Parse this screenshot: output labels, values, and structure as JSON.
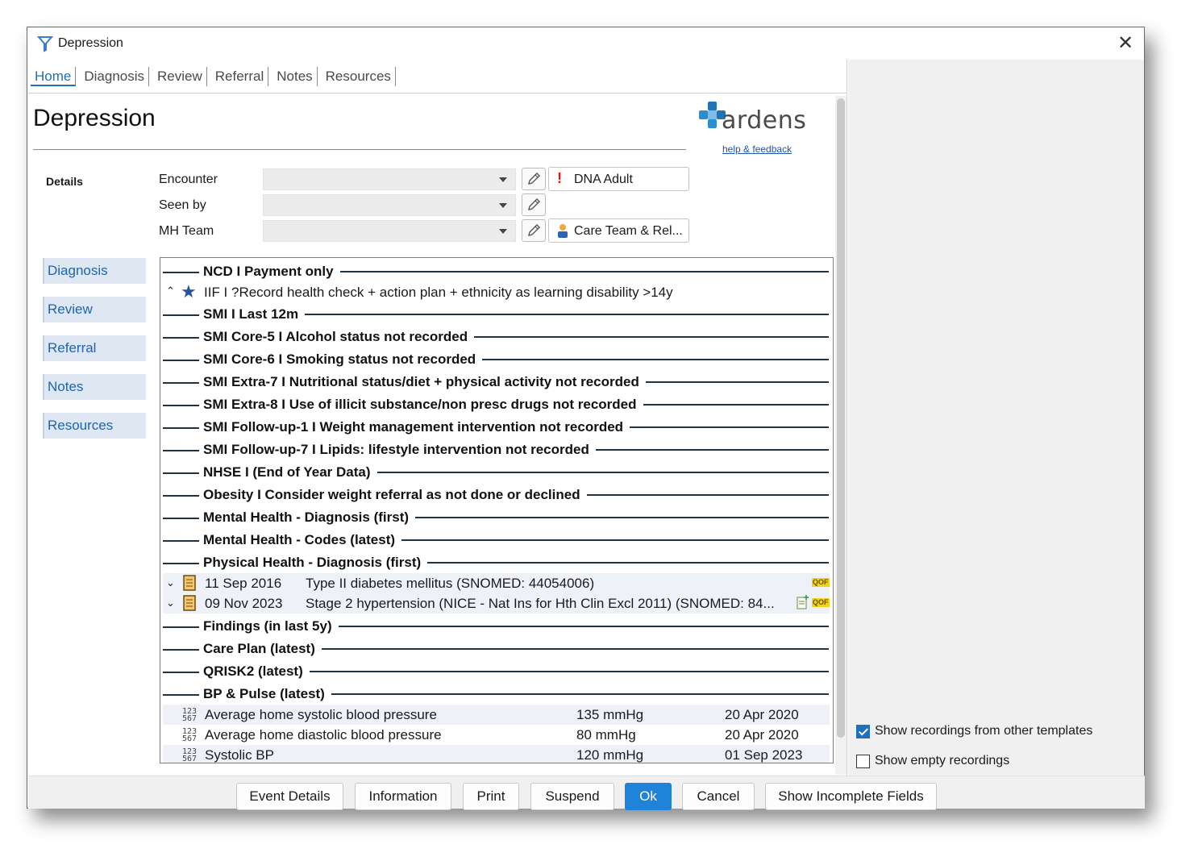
{
  "window": {
    "title": "Depression",
    "close_icon": "close-icon"
  },
  "tabs": [
    {
      "label": "Home",
      "active": true
    },
    {
      "label": "Diagnosis"
    },
    {
      "label": "Review"
    },
    {
      "label": "Referral"
    },
    {
      "label": "Notes"
    },
    {
      "label": "Resources"
    }
  ],
  "page": {
    "title": "Depression"
  },
  "logo": {
    "wordmark": "ardens",
    "help_link": "help & feedback",
    "brand_color": "#1f73b7"
  },
  "details": {
    "label": "Details",
    "fields": [
      {
        "label": "Encounter",
        "value": ""
      },
      {
        "label": "Seen by",
        "value": ""
      },
      {
        "label": "MH Team",
        "value": ""
      }
    ],
    "dna_button": "DNA Adult",
    "care_team_button": "Care Team & Rel..."
  },
  "sidenav": [
    {
      "label": "Diagnosis"
    },
    {
      "label": "Review"
    },
    {
      "label": "Referral"
    },
    {
      "label": "Notes"
    },
    {
      "label": "Resources"
    }
  ],
  "list": {
    "sections_a": [
      "NCD I Payment only"
    ],
    "iif_row": "IIF I ?Record health check + action plan + ethnicity as learning disability >14y",
    "sections_b": [
      "SMI I Last 12m",
      "SMI Core-5 I Alcohol status not recorded",
      "SMI Core-6 I Smoking status not recorded",
      "SMI Extra-7 I Nutritional status/diet + physical activity not recorded",
      "SMI Extra-8 I Use of illicit substance/non presc drugs not recorded",
      "SMI Follow-up-1 I Weight management intervention not recorded",
      "SMI Follow-up-7 I Lipids: lifestyle intervention not recorded",
      "NHSE I (End of Year Data)",
      "Obesity I Consider weight referral as not done or declined",
      "Mental Health - Diagnosis (first)",
      "Mental Health - Codes (latest)",
      "Physical Health - Diagnosis (first)"
    ],
    "records": [
      {
        "date": "11 Sep 2016",
        "desc": "Type II diabetes mellitus (SNOMED: 44054006)",
        "badge": "QOF"
      },
      {
        "date": "09 Nov 2023",
        "desc": "Stage 2 hypertension (NICE - Nat Ins for Hth Clin Excl 2011) (SNOMED: 84...",
        "badge": "QOF"
      }
    ],
    "sections_c": [
      "Findings (in last 5y)",
      "Care Plan (latest)",
      "QRISK2 (latest)",
      "BP & Pulse (latest)"
    ],
    "values": [
      {
        "name": "Average home systolic blood pressure",
        "value": "135 mmHg",
        "date": "20 Apr 2020"
      },
      {
        "name": "Average home diastolic blood pressure",
        "value": "80 mmHg",
        "date": "20 Apr 2020"
      },
      {
        "name": "Systolic BP",
        "value": "120 mmHg",
        "date": "01 Sep 2023"
      }
    ]
  },
  "options": {
    "show_other_templates": "Show recordings from other templates",
    "show_other_templates_checked": true,
    "show_empty": "Show empty recordings",
    "show_empty_checked": false
  },
  "buttons": {
    "event_details": "Event Details",
    "information": "Information",
    "print": "Print",
    "suspend": "Suspend",
    "ok": "Ok",
    "cancel": "Cancel",
    "show_incomplete": "Show Incomplete Fields"
  }
}
